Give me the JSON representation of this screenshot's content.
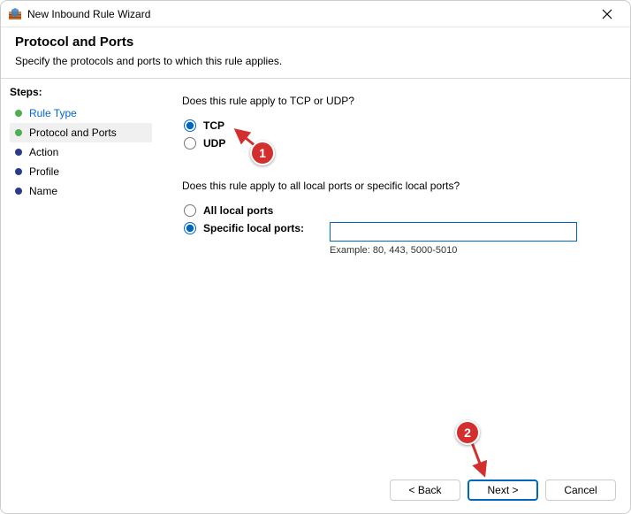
{
  "titlebar": {
    "title": "New Inbound Rule Wizard"
  },
  "header": {
    "title": "Protocol and Ports",
    "subtitle": "Specify the protocols and ports to which this rule applies."
  },
  "sidebar": {
    "steps_label": "Steps:",
    "items": [
      {
        "label": "Rule Type",
        "state": "completed"
      },
      {
        "label": "Protocol and Ports",
        "state": "current"
      },
      {
        "label": "Action",
        "state": "pending"
      },
      {
        "label": "Profile",
        "state": "pending"
      },
      {
        "label": "Name",
        "state": "pending"
      }
    ]
  },
  "content": {
    "protocol_question": "Does this rule apply to TCP or UDP?",
    "tcp_label": "TCP",
    "udp_label": "UDP",
    "protocol_selected": "tcp",
    "ports_question": "Does this rule apply to all local ports or specific local ports?",
    "all_ports_label": "All local ports",
    "specific_ports_label": "Specific local ports:",
    "ports_selected": "specific",
    "ports_value": "",
    "ports_example": "Example: 80, 443, 5000-5010"
  },
  "footer": {
    "back_label": "< Back",
    "next_label": "Next >",
    "cancel_label": "Cancel"
  },
  "annotations": {
    "badge1": "1",
    "badge2": "2"
  }
}
